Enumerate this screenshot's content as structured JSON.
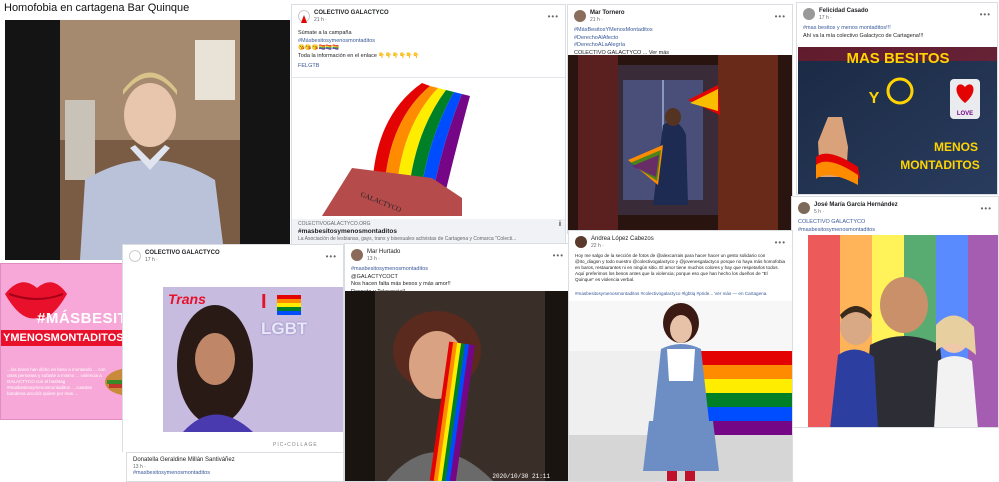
{
  "video": {
    "title": "Homofobia en cartagena Bar Quinque"
  },
  "post_main": {
    "author": "COLECTIVO GALACTYCO",
    "time": "21 h ·",
    "line1": "Súmate a la campaña",
    "hashtag": "#Másbesitosymenosmontaditos",
    "emoji_row": "😘😘😘🏳️‍🌈🏳️‍🌈🏳️‍🌈",
    "info": "Toda la información en el enlace 👇👇👇👇👇👇",
    "link_tag": "FELGTB",
    "art_text": "GALACTYCO",
    "link_domain": "COLECTIVOGALACTYCO.ORG",
    "link_title": "#masbesitosymenosmontaditos",
    "link_desc": "La Asociación de lesbianas, gays, trans y bisexuales activistas de Cartagena y Comarca \"Colecti..."
  },
  "post_fan": {
    "author": "Mar Tornero",
    "time": "21 h ·",
    "tags": [
      "#MásBesitosYMenosMontaditos",
      "#DerechoAlAfecto",
      "#DerechoALaAlegría"
    ],
    "body": "COLECTIVO GALACTYCO ... Ver más"
  },
  "post_felicidad": {
    "author": "Felicidad Casado",
    "time": "17 h ·",
    "line1": "#mas besitos y menos montaditos!!!",
    "line2": "Ahí va la mía colectivo Galactyco de Cartagena!!!",
    "banner_top": "MAS BESITOS",
    "banner_y": "Y",
    "banner_bottom1": "MENOS",
    "banner_bottom2": "MONTADITOS",
    "love": "LOVE"
  },
  "post_jose": {
    "author": "José María García Hernández",
    "time": "5 h ·",
    "line1": "COLECTIVO GALACTYCO",
    "line2": "#masbesitosymenosmontaditos"
  },
  "post_galactyco2": {
    "author": "COLECTIVO GALACTYCO",
    "time": "17 h ·"
  },
  "post_pink": {
    "hashtag1": "#MÁSBESITOS",
    "hashtag2": "YMENOSMONTADITOS",
    "body": "...los bares han dicho en beso a montando ... con otras personas y sufaste a mismo ... violencia a GALACTYCO con el hashtag #masbesitosymenosmontaditos ... cuantas banderas arcoíris quiere por mas ...",
    "trans": "Trans",
    "i": "I",
    "lgbt": "LGBT",
    "collage": "PIC•COLLAGE"
  },
  "post_donatella": {
    "author": "Donatella Geraldine Millán Santiváñez",
    "time": "13 h ·",
    "hashtag": "#masbesitosymenosmontaditos"
  },
  "post_mar_hurtado": {
    "author": "Mar Hurtado",
    "time": "13 h ·",
    "tag": "#masbesitosymenosmontaditos",
    "mention": "@GALACTYCOCT",
    "line1": "Nos hacen falta más besos y más amor!!",
    "line2": "Respeto y Tolerancia!!",
    "timestamp": "2020/10/30 21:11"
  },
  "post_andrea": {
    "author": "Andrea López Cabezos",
    "time": "22 h ·",
    "body": "Hoy me salgo de la sección de fotos de @alexcarrais para hacer hacer un gesto solidario con @ito_diagon y todo nuestro @colectivogalactyco y @jovenesgalactyco porque no haya más homofobia en baros, restaurantes ni en ningún sitio. El amor tiene muchos colores y hay que respetarlos todos. Aquí preferimos los besos antes que la violencia; porque eso que han hecho los dueños de \"El Quinque\" es violencia verbal.",
    "tags": "#masbesitosymenosmontaditos #colectivogalactyco #lgbtiq #pride... Ver más — en Cartagena."
  },
  "colors": {
    "pink_bg": "#f7a8d8",
    "pink_text": "#ffffff",
    "fb_link": "#385898",
    "rainbow": [
      "#e40303",
      "#ff8c00",
      "#ffed00",
      "#008026",
      "#004dff",
      "#750787"
    ]
  }
}
